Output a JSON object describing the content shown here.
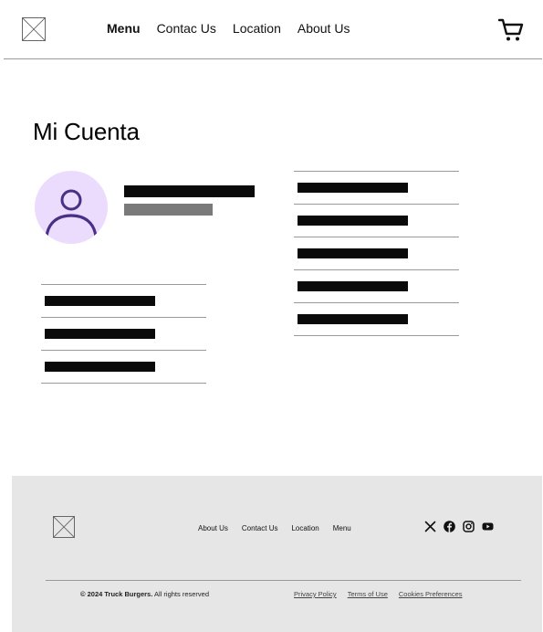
{
  "header": {
    "nav": [
      {
        "label": "Menu",
        "active": true
      },
      {
        "label": "Contac Us",
        "active": false
      },
      {
        "label": "Location",
        "active": false
      },
      {
        "label": "About Us",
        "active": false
      }
    ],
    "cart_icon": "cart-icon",
    "logo_icon": "image-placeholder-icon"
  },
  "main": {
    "title": "Mi Cuenta",
    "avatar_icon": "user-icon",
    "avatar_color": "#ebdcfd",
    "avatar_accent": "#4a2f86"
  },
  "footer": {
    "logo_icon": "image-placeholder-icon",
    "nav": [
      "About Us",
      "Contact Us",
      "Location",
      "Menu"
    ],
    "social_icons": [
      "x-icon",
      "facebook-icon",
      "instagram-icon",
      "youtube-icon"
    ],
    "copyright_brand": "© 2024 Truck Burgers.",
    "copyright_rest": " All rights reserved",
    "legal": [
      "Privacy Policy",
      "Terms of Use",
      "Cookies Preferences"
    ],
    "background": "#e6e6e6"
  }
}
